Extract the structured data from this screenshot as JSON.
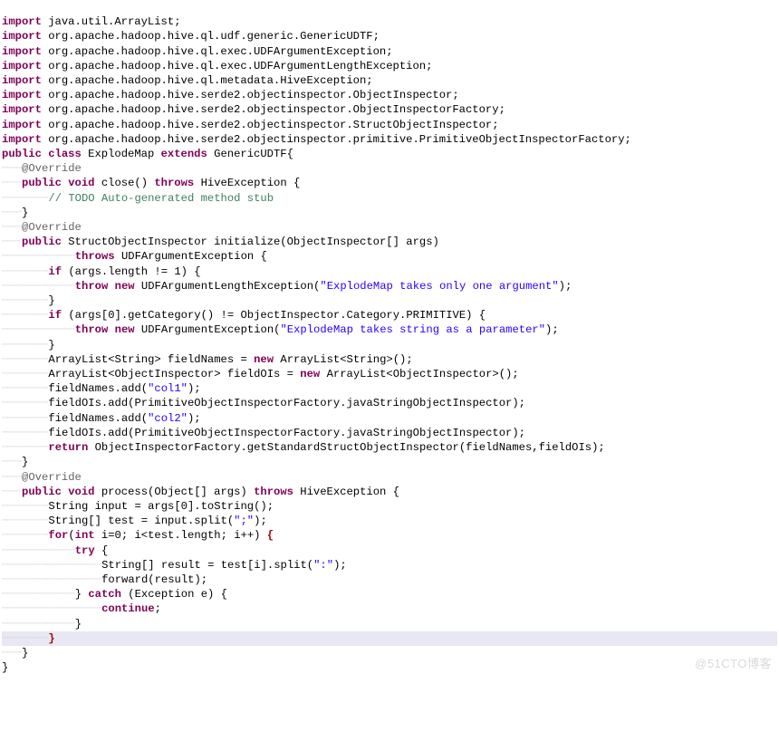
{
  "code": {
    "imports": [
      "java.util.ArrayList",
      "org.apache.hadoop.hive.ql.udf.generic.GenericUDTF",
      "org.apache.hadoop.hive.ql.exec.UDFArgumentException",
      "org.apache.hadoop.hive.ql.exec.UDFArgumentLengthException",
      "org.apache.hadoop.hive.ql.metadata.HiveException",
      "org.apache.hadoop.hive.serde2.objectinspector.ObjectInspector",
      "org.apache.hadoop.hive.serde2.objectinspector.ObjectInspectorFactory",
      "org.apache.hadoop.hive.serde2.objectinspector.StructObjectInspector",
      "org.apache.hadoop.hive.serde2.objectinspector.primitive.PrimitiveObjectInspectorFactory"
    ],
    "classDecl": {
      "kw_public": "public",
      "kw_class": "class",
      "name": "ExplodeMap",
      "kw_extends": "extends",
      "superType": "GenericUDTF"
    },
    "close": {
      "annotation": "@Override",
      "sig_public": "public",
      "sig_void": "void",
      "sig_name": "close()",
      "sig_throws": "throws",
      "sig_exc": "HiveException",
      "todo": "// TODO Auto-generated method stub"
    },
    "initialize": {
      "annotation": "@Override",
      "sig_public": "public",
      "sig_ret": "StructObjectInspector",
      "sig_name": "initialize(ObjectInspector[] args)",
      "sig_throws": "throws",
      "sig_exc": "UDFArgumentException",
      "if1_kw": "if",
      "if1_cond": " (args.length != 1) {",
      "throw1_kw": "throw",
      "throw1_new": "new",
      "throw1_type": " UDFArgumentLengthException(",
      "throw1_str": "\"ExplodeMap takes only one argument\"",
      "throw1_end": ");",
      "if2_kw": "if",
      "if2_cond": " (args[0].getCategory() != ObjectInspector.Category.PRIMITIVE) {",
      "throw2_kw": "throw",
      "throw2_new": "new",
      "throw2_type": " UDFArgumentException(",
      "throw2_str": "\"ExplodeMap takes string as a parameter\"",
      "throw2_end": ");",
      "line_fieldNames_decl_pre": "ArrayList<String> fieldNames = ",
      "kw_new1": "new",
      "line_fieldNames_decl_post": " ArrayList<String>();",
      "line_fieldOIs_decl_pre": "ArrayList<ObjectInspector> fieldOIs = ",
      "kw_new2": "new",
      "line_fieldOIs_decl_post": " ArrayList<ObjectInspector>();",
      "addN1_pre": "fieldNames.add(",
      "addN1_str": "\"col1\"",
      "addN1_post": ");",
      "addO1": "fieldOIs.add(PrimitiveObjectInspectorFactory.javaStringObjectInspector);",
      "addN2_pre": "fieldNames.add(",
      "addN2_str": "\"col2\"",
      "addN2_post": ");",
      "addO2": "fieldOIs.add(PrimitiveObjectInspectorFactory.javaStringObjectInspector);",
      "ret_kw": "return",
      "ret_rest": " ObjectInspectorFactory.getStandardStructObjectInspector(fieldNames,fieldOIs);"
    },
    "process": {
      "annotation": "@Override",
      "sig_public": "public",
      "sig_void": "void",
      "sig_name": "process(Object[] args)",
      "sig_throws": "throws",
      "sig_exc": "HiveException",
      "l1": "String input = args[0].toString();",
      "l2_pre": "String[] test = input.split(",
      "l2_str": "\";\"",
      "l2_post": ");",
      "for_kw": "for",
      "for_open": "(",
      "for_int": "int",
      "for_rest": " i=0; i<test.length; i++) ",
      "for_brace": "{",
      "try_kw": "try",
      "try_body_pre": "String[] result = test[i].split(",
      "try_body_str": "\":\"",
      "try_body_post": ");",
      "forward": "forward(result);",
      "catch_kw": "catch",
      "catch_part": " (Exception e) {",
      "continue_kw": "continue",
      "continue_end": ";",
      "for_close": "}"
    },
    "kw_import": "import"
  },
  "watermark": "@51CTO博客"
}
